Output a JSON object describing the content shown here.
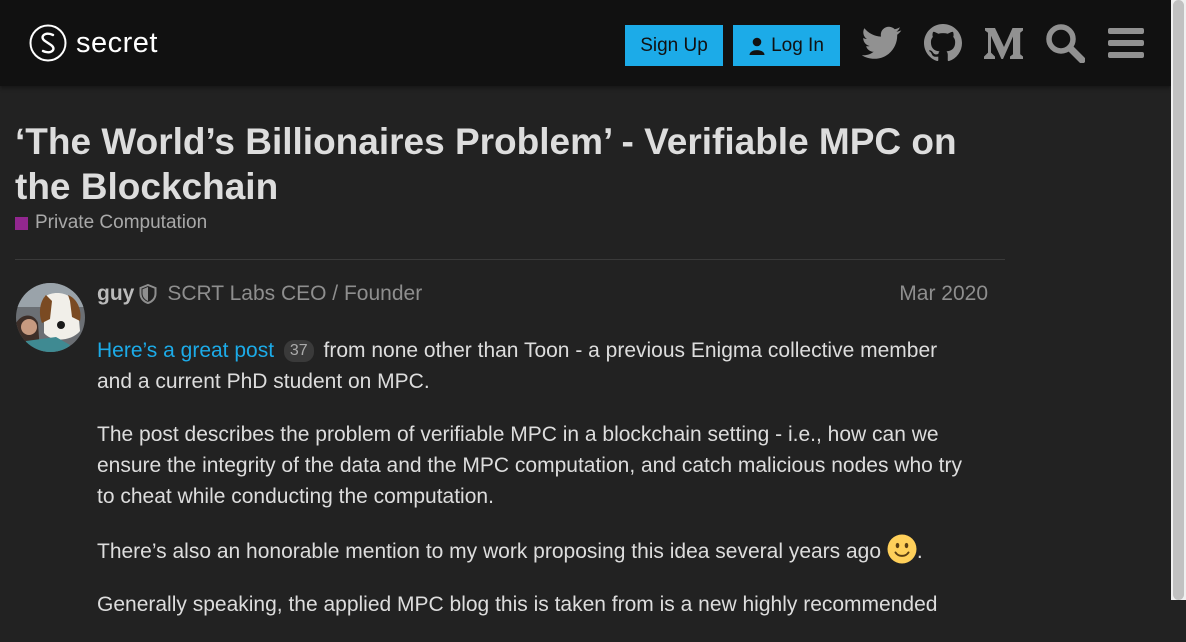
{
  "header": {
    "logo_text": "secret",
    "signup_label": "Sign Up",
    "login_label": "Log In",
    "icons": [
      "twitter-icon",
      "github-icon",
      "medium-icon",
      "search-icon",
      "hamburger-menu-icon"
    ]
  },
  "topic": {
    "title": "‘The World’s Billionaires Problem’ - Verifiable MPC on the Blockchain",
    "category": "Private Computation",
    "category_color": "#92278f"
  },
  "post": {
    "username": "guy",
    "user_title": "SCRT Labs CEO / Founder",
    "date": "Mar 2020",
    "p1_link": "Here’s a great post",
    "p1_clicks": "37",
    "p1_text": "from none other than Toon - a previous Enigma collective member and a current PhD student on MPC.",
    "p2": "The post describes the problem of verifiable MPC in a blockchain setting - i.e., how can we ensure the integrity of the data and the MPC computation, and catch malicious nodes who try to cheat while conducting the computation.",
    "p3": "There’s also an honorable mention to my work proposing this idea several years ago",
    "p3_end": ".",
    "p4": "Generally speaking, the applied MPC blog this is taken from is a new highly recommended"
  },
  "colors": {
    "accent": "#1cabe8",
    "background": "#222222",
    "header": "#111111"
  }
}
